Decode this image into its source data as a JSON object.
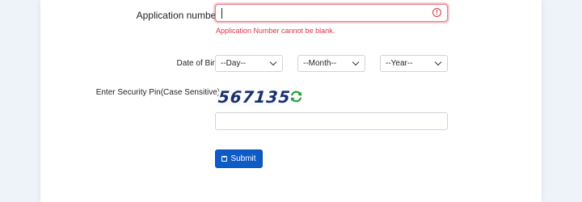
{
  "form": {
    "application_number": {
      "label": "Application number",
      "required_mark": "*",
      "value": "",
      "error": "Application Number cannot be blank."
    },
    "date_of_birth": {
      "label": "Date of Birth",
      "required_mark": "*",
      "day": "--Day--",
      "month": "--Month--",
      "year": "--Year--"
    },
    "security_pin": {
      "label": "Enter Security Pin(Case Sensitive)",
      "required_mark": "*",
      "captcha_text": "567135",
      "value": ""
    },
    "submit_label": "Submit"
  },
  "colors": {
    "error": "#dc3545",
    "primary": "#0d5bc7",
    "refresh": "#1e9e3a",
    "captcha": "#1a2f6e"
  },
  "icons": {
    "error": "exclamation-circle-icon",
    "refresh": "refresh-icon",
    "submit": "save-icon"
  }
}
